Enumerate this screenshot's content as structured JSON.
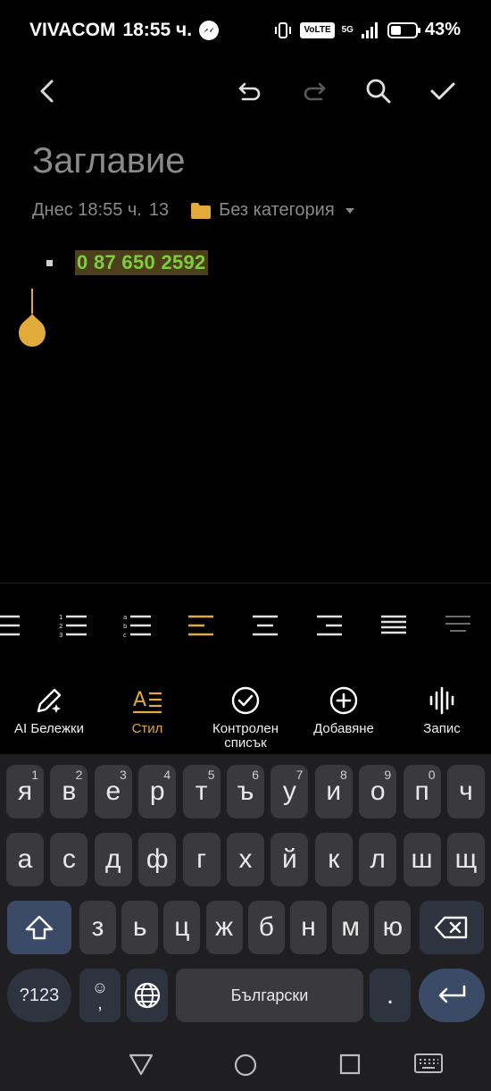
{
  "status": {
    "carrier": "VIVACOM",
    "time": "18:55 ч.",
    "volte": "VoLTE",
    "network": "5G",
    "battery": "43%",
    "battery_level": 0.43
  },
  "note": {
    "title_placeholder": "Заглавие",
    "date": "Днес 18:55 ч.",
    "char_count": "13",
    "category": "Без категория",
    "bullet_text": "0 87 650 2592"
  },
  "tools": [
    {
      "label": "AI Бележки"
    },
    {
      "label": "Стил"
    },
    {
      "label": "Контролен",
      "label2": "списък"
    },
    {
      "label": "Добавяне"
    },
    {
      "label": "Запис"
    }
  ],
  "keyboard": {
    "row1": [
      {
        "k": "я",
        "s": "1"
      },
      {
        "k": "в",
        "s": "2"
      },
      {
        "k": "е",
        "s": "3"
      },
      {
        "k": "р",
        "s": "4"
      },
      {
        "k": "т",
        "s": "5"
      },
      {
        "k": "ъ",
        "s": "6"
      },
      {
        "k": "у",
        "s": "7"
      },
      {
        "k": "и",
        "s": "8"
      },
      {
        "k": "о",
        "s": "9"
      },
      {
        "k": "п",
        "s": "0"
      },
      {
        "k": "ч",
        "s": ""
      }
    ],
    "row2": [
      "а",
      "с",
      "д",
      "ф",
      "г",
      "х",
      "й",
      "к",
      "л",
      "ш",
      "щ"
    ],
    "row3": [
      "з",
      "ь",
      "ц",
      "ж",
      "б",
      "н",
      "м",
      "ю"
    ],
    "sym_label": "?123",
    "space_label": "Български",
    "period": ".",
    "emoji_comma": ","
  },
  "colors": {
    "accent": "#e2a93b",
    "highlight_text": "#7ccf3a",
    "highlight_bg": "#4b3f1c"
  }
}
